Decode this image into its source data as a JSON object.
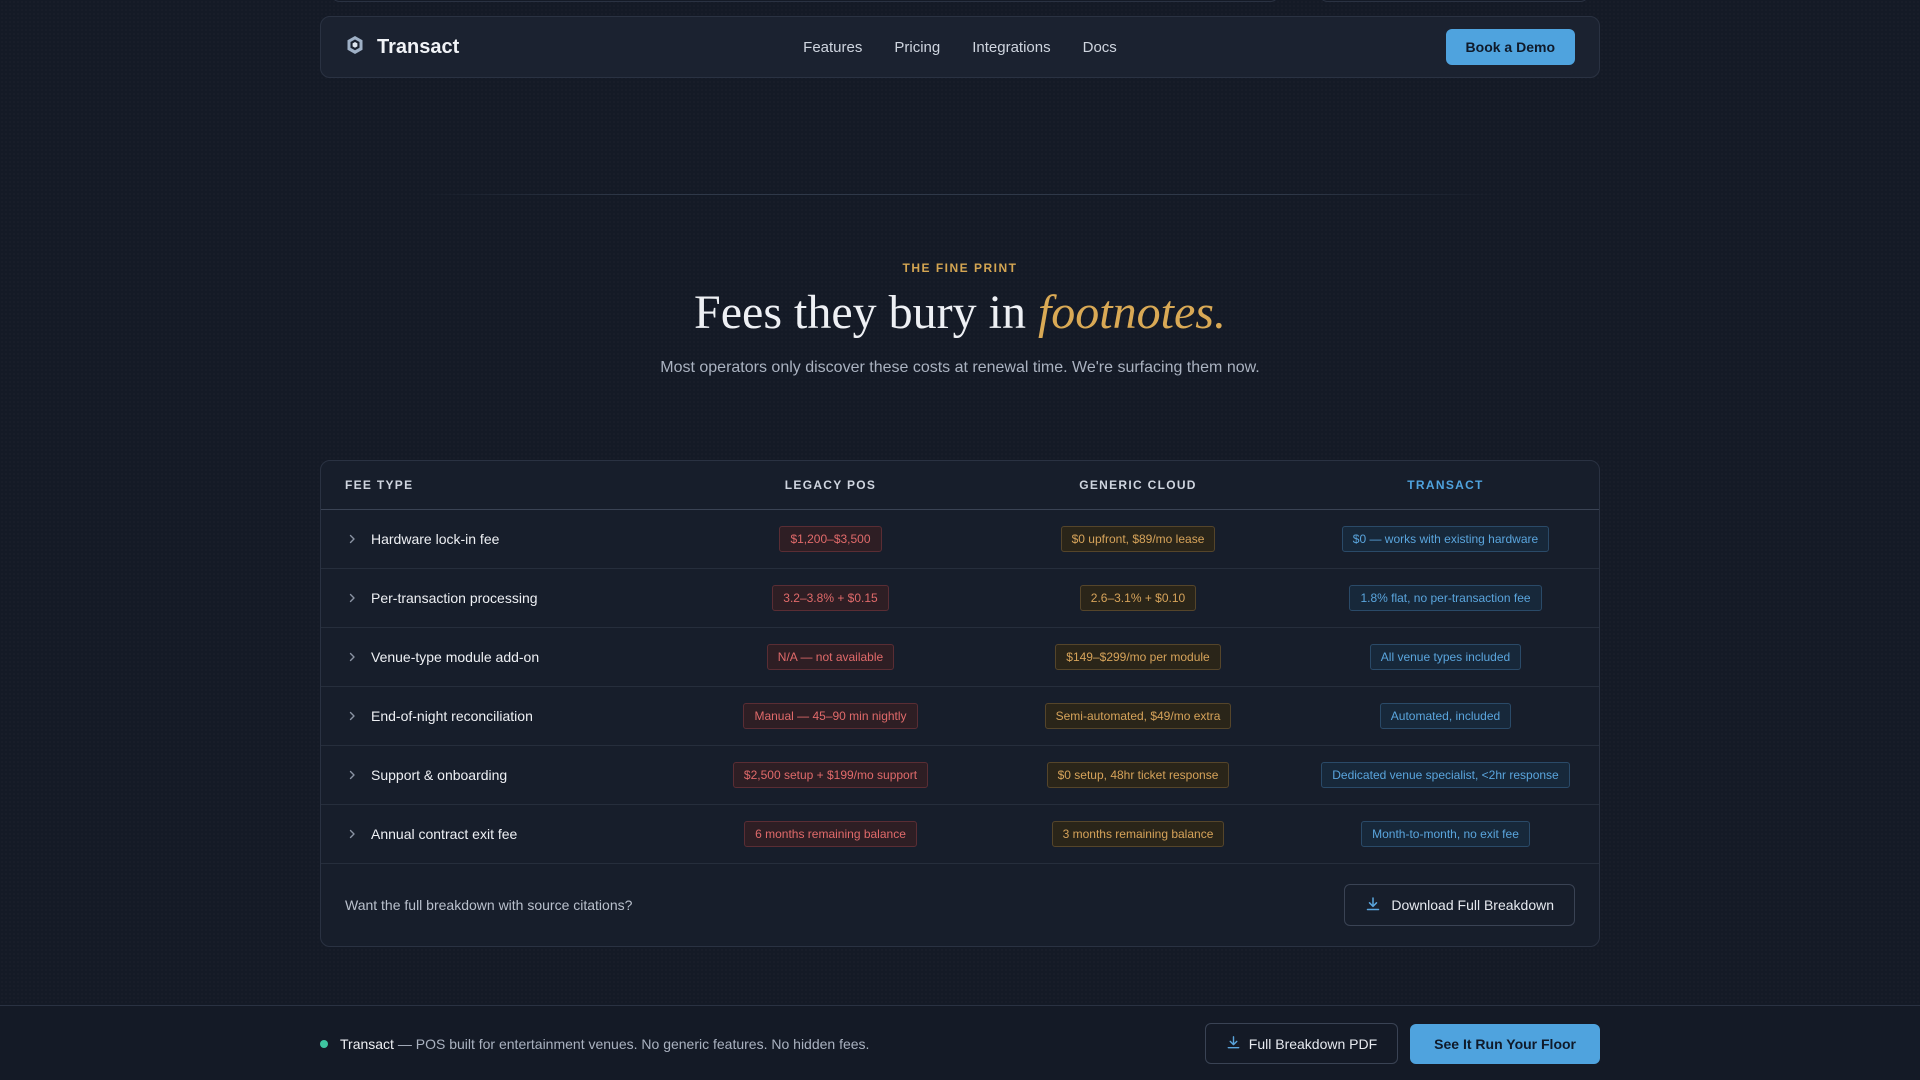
{
  "nav": {
    "brand": "Transact",
    "links": [
      "Features",
      "Pricing",
      "Integrations",
      "Docs"
    ],
    "cta": "Book a Demo"
  },
  "hero": {
    "eyebrow": "THE FINE PRINT",
    "headline_main": "Fees they bury in ",
    "headline_accent": "footnotes.",
    "subhead": "Most operators only discover these costs at renewal time. We're surfacing them now."
  },
  "table": {
    "headers": [
      "FEE TYPE",
      "LEGACY POS",
      "GENERIC CLOUD",
      "TRANSACT"
    ],
    "rows": [
      {
        "label": "Hardware lock-in fee",
        "legacy": "$1,200–$3,500",
        "generic": "$0 upfront, $89/mo lease",
        "transact": "$0 — works with existing hardware"
      },
      {
        "label": "Per-transaction processing",
        "legacy": "3.2–3.8% + $0.15",
        "generic": "2.6–3.1% + $0.10",
        "transact": "1.8% flat, no per-transaction fee"
      },
      {
        "label": "Venue-type module add-on",
        "legacy": "N/A — not available",
        "generic": "$149–$299/mo per module",
        "transact": "All venue types included"
      },
      {
        "label": "End-of-night reconciliation",
        "legacy": "Manual — 45–90 min nightly",
        "generic": "Semi-automated, $49/mo extra",
        "transact": "Automated, included"
      },
      {
        "label": "Support & onboarding",
        "legacy": "$2,500 setup + $199/mo support",
        "generic": "$0 setup, 48hr ticket response",
        "transact": "Dedicated venue specialist, <2hr response"
      },
      {
        "label": "Annual contract exit fee",
        "legacy": "6 months remaining balance",
        "generic": "3 months remaining balance",
        "transact": "Month-to-month, no exit fee"
      }
    ],
    "footer_text": "Want the full breakdown with source citations?",
    "download_label": "Download Full Breakdown"
  },
  "footer": {
    "brand": "Transact",
    "tagline": " — POS built for entertainment venues. No generic features. No hidden fees.",
    "pdf_label": "Full Breakdown PDF",
    "cta": "See It Run Your Floor"
  },
  "colors": {
    "accent_blue": "#4fa3de",
    "accent_gold": "#d9a955",
    "status_dot": "#3ec5a0"
  }
}
